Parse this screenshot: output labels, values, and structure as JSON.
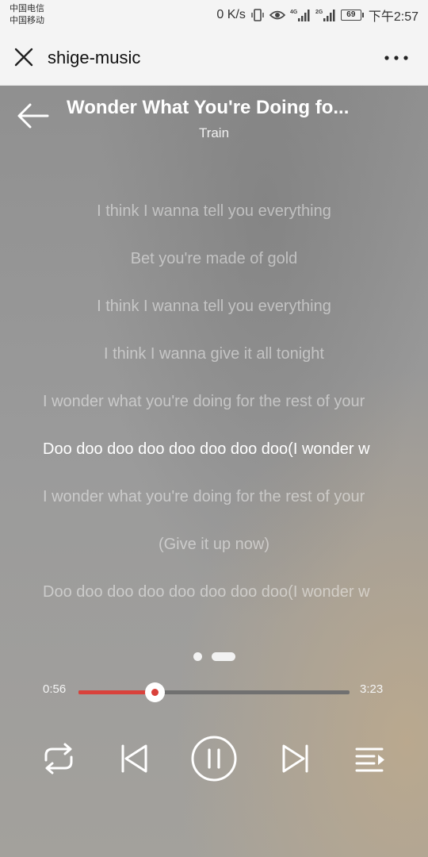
{
  "status_bar": {
    "carrier_1": "中国电信",
    "carrier_2": "中国移动",
    "net_speed": "0 K/s",
    "battery": "69",
    "time": "下午2:57"
  },
  "header": {
    "title": "shige-music",
    "close_icon": "close-icon",
    "more_icon": "more-icon"
  },
  "player": {
    "song_title": "Wonder What You're Doing fo...",
    "artist": "Train",
    "lyrics": [
      "I think I wanna tell you everything",
      "Bet you're made of gold",
      "I think I wanna tell you everything",
      "I think I wanna give it all tonight",
      "I wonder what you're doing for the rest of your",
      "Doo doo doo doo doo doo doo doo(I wonder w",
      "I wonder what you're doing for the rest of your",
      "(Give it up now)",
      "Doo doo doo doo doo doo doo doo(I wonder w"
    ],
    "active_lyric_index": 5,
    "current_time": "0:56",
    "total_time": "3:23",
    "progress_fraction": 0.28,
    "page_indicator": {
      "count": 2,
      "active": 1
    },
    "accent_color": "#d9413b"
  }
}
